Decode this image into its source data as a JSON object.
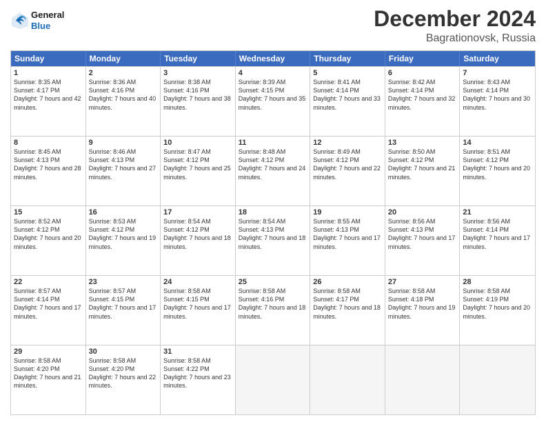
{
  "logo": {
    "line1": "General",
    "line2": "Blue"
  },
  "title": "December 2024",
  "subtitle": "Bagrationovsk, Russia",
  "days": [
    "Sunday",
    "Monday",
    "Tuesday",
    "Wednesday",
    "Thursday",
    "Friday",
    "Saturday"
  ],
  "weeks": [
    [
      {
        "day": 1,
        "rise": "8:35 AM",
        "set": "4:17 PM",
        "daylight": "7 hours and 42 minutes."
      },
      {
        "day": 2,
        "rise": "8:36 AM",
        "set": "4:16 PM",
        "daylight": "7 hours and 40 minutes."
      },
      {
        "day": 3,
        "rise": "8:38 AM",
        "set": "4:16 PM",
        "daylight": "7 hours and 38 minutes."
      },
      {
        "day": 4,
        "rise": "8:39 AM",
        "set": "4:15 PM",
        "daylight": "7 hours and 35 minutes."
      },
      {
        "day": 5,
        "rise": "8:41 AM",
        "set": "4:14 PM",
        "daylight": "7 hours and 33 minutes."
      },
      {
        "day": 6,
        "rise": "8:42 AM",
        "set": "4:14 PM",
        "daylight": "7 hours and 32 minutes."
      },
      {
        "day": 7,
        "rise": "8:43 AM",
        "set": "4:14 PM",
        "daylight": "7 hours and 30 minutes."
      }
    ],
    [
      {
        "day": 8,
        "rise": "8:45 AM",
        "set": "4:13 PM",
        "daylight": "7 hours and 28 minutes."
      },
      {
        "day": 9,
        "rise": "8:46 AM",
        "set": "4:13 PM",
        "daylight": "7 hours and 27 minutes."
      },
      {
        "day": 10,
        "rise": "8:47 AM",
        "set": "4:12 PM",
        "daylight": "7 hours and 25 minutes."
      },
      {
        "day": 11,
        "rise": "8:48 AM",
        "set": "4:12 PM",
        "daylight": "7 hours and 24 minutes."
      },
      {
        "day": 12,
        "rise": "8:49 AM",
        "set": "4:12 PM",
        "daylight": "7 hours and 22 minutes."
      },
      {
        "day": 13,
        "rise": "8:50 AM",
        "set": "4:12 PM",
        "daylight": "7 hours and 21 minutes."
      },
      {
        "day": 14,
        "rise": "8:51 AM",
        "set": "4:12 PM",
        "daylight": "7 hours and 20 minutes."
      }
    ],
    [
      {
        "day": 15,
        "rise": "8:52 AM",
        "set": "4:12 PM",
        "daylight": "7 hours and 20 minutes."
      },
      {
        "day": 16,
        "rise": "8:53 AM",
        "set": "4:12 PM",
        "daylight": "7 hours and 19 minutes."
      },
      {
        "day": 17,
        "rise": "8:54 AM",
        "set": "4:12 PM",
        "daylight": "7 hours and 18 minutes."
      },
      {
        "day": 18,
        "rise": "8:54 AM",
        "set": "4:13 PM",
        "daylight": "7 hours and 18 minutes."
      },
      {
        "day": 19,
        "rise": "8:55 AM",
        "set": "4:13 PM",
        "daylight": "7 hours and 17 minutes."
      },
      {
        "day": 20,
        "rise": "8:56 AM",
        "set": "4:13 PM",
        "daylight": "7 hours and 17 minutes."
      },
      {
        "day": 21,
        "rise": "8:56 AM",
        "set": "4:14 PM",
        "daylight": "7 hours and 17 minutes."
      }
    ],
    [
      {
        "day": 22,
        "rise": "8:57 AM",
        "set": "4:14 PM",
        "daylight": "7 hours and 17 minutes."
      },
      {
        "day": 23,
        "rise": "8:57 AM",
        "set": "4:15 PM",
        "daylight": "7 hours and 17 minutes."
      },
      {
        "day": 24,
        "rise": "8:58 AM",
        "set": "4:15 PM",
        "daylight": "7 hours and 17 minutes."
      },
      {
        "day": 25,
        "rise": "8:58 AM",
        "set": "4:16 PM",
        "daylight": "7 hours and 18 minutes."
      },
      {
        "day": 26,
        "rise": "8:58 AM",
        "set": "4:17 PM",
        "daylight": "7 hours and 18 minutes."
      },
      {
        "day": 27,
        "rise": "8:58 AM",
        "set": "4:18 PM",
        "daylight": "7 hours and 19 minutes."
      },
      {
        "day": 28,
        "rise": "8:58 AM",
        "set": "4:19 PM",
        "daylight": "7 hours and 20 minutes."
      }
    ],
    [
      {
        "day": 29,
        "rise": "8:58 AM",
        "set": "4:20 PM",
        "daylight": "7 hours and 21 minutes."
      },
      {
        "day": 30,
        "rise": "8:58 AM",
        "set": "4:20 PM",
        "daylight": "7 hours and 22 minutes."
      },
      {
        "day": 31,
        "rise": "8:58 AM",
        "set": "4:22 PM",
        "daylight": "7 hours and 23 minutes."
      },
      null,
      null,
      null,
      null
    ]
  ]
}
